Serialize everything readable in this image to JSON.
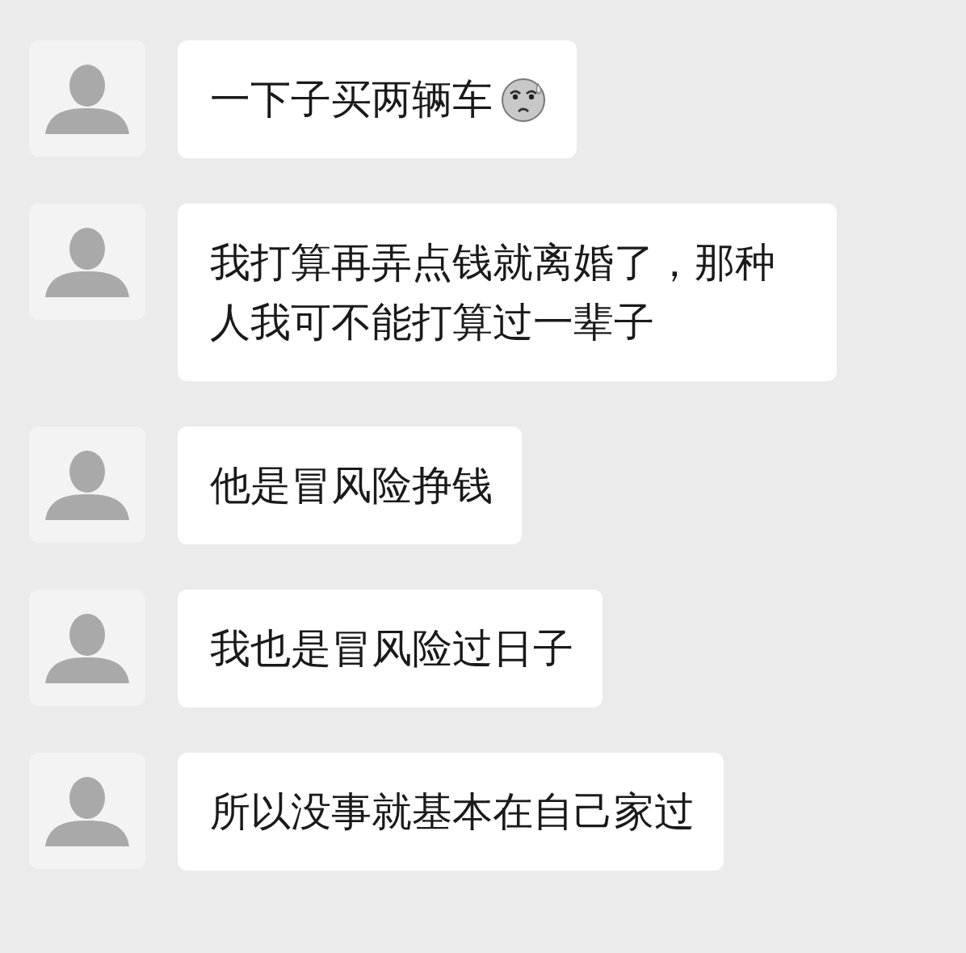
{
  "messages": [
    {
      "kind": "text_with_emoji",
      "text": "一下子买两辆车"
    },
    {
      "kind": "text",
      "text": "我打算再弄点钱就离婚了，那种人我可不能打算过一辈子"
    },
    {
      "kind": "text",
      "text": "他是冒风险挣钱"
    },
    {
      "kind": "text",
      "text": "我也是冒风险过日子"
    },
    {
      "kind": "text",
      "text": "所以没事就基本在自己家过"
    }
  ]
}
